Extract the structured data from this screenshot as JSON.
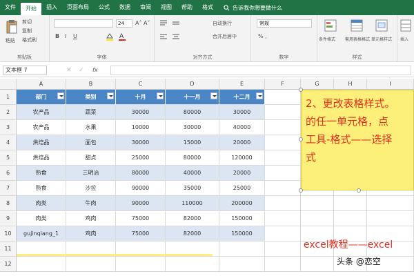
{
  "menu": {
    "tabs": [
      "文件",
      "开始",
      "插入",
      "页面布局",
      "公式",
      "数据",
      "审阅",
      "视图",
      "帮助",
      "格式"
    ],
    "active_index": 1,
    "tell_me": "告诉我你想要做什么"
  },
  "ribbon": {
    "clipboard": {
      "paste": "粘贴",
      "cut": "剪切",
      "copy": "复制",
      "format_painter": "格式刷",
      "label": "剪贴板"
    },
    "font": {
      "size": "24",
      "bold": "B",
      "italic": "I",
      "underline": "U",
      "label": "字体"
    },
    "align": {
      "wrap": "自动换行",
      "merge": "合并后居中",
      "label": "对齐方式"
    },
    "number": {
      "format": "常规",
      "label": "数字"
    },
    "styles": {
      "cond": "条件格式",
      "table": "套用表格格式",
      "cell": "单元格样式",
      "label": "样式"
    },
    "cells": {
      "insert": "插入"
    }
  },
  "formula_bar": {
    "name_box": "文本框 7",
    "fx": "fx"
  },
  "columns": [
    "A",
    "B",
    "C",
    "D",
    "E",
    "F",
    "G",
    "H",
    "I"
  ],
  "rows": [
    "1",
    "2",
    "3",
    "4",
    "5",
    "6",
    "7",
    "8",
    "9",
    "10",
    "11",
    "12"
  ],
  "table": {
    "headers": [
      "部门",
      "类别",
      "十月",
      "十一月",
      "十二月"
    ],
    "data": [
      [
        "农产品",
        "蔬菜",
        "30000",
        "80000",
        "30000"
      ],
      [
        "农产品",
        "水果",
        "10000",
        "30000",
        "40000"
      ],
      [
        "烘焙品",
        "面包",
        "30000",
        "15000",
        "20000"
      ],
      [
        "烘焙品",
        "甜点",
        "25000",
        "80000",
        "120000"
      ],
      [
        "熟食",
        "三明治",
        "80000",
        "40000",
        "20000"
      ],
      [
        "熟食",
        "沙拉",
        "90000",
        "35000",
        "25000"
      ],
      [
        "肉类",
        "牛肉",
        "90000",
        "110000",
        "200000"
      ],
      [
        "肉类",
        "鸡肉",
        "75000",
        "82000",
        "150000"
      ],
      [
        "gujinqiang_1",
        "鸡肉",
        "75000",
        "82000",
        "150000"
      ]
    ]
  },
  "note": {
    "line1": "2、更改表格样式。",
    "line2": "的任一单元格，点",
    "line3": "工具-格式——选择",
    "line4": "式"
  },
  "footer_text": "excel教程——excel",
  "watermark": "头条 @恋空",
  "colors": {
    "excel_green": "#217346",
    "table_header": "#4a86c5",
    "band": "#dce6f2",
    "note_bg": "#fdf07a",
    "note_text": "#e0301e"
  }
}
